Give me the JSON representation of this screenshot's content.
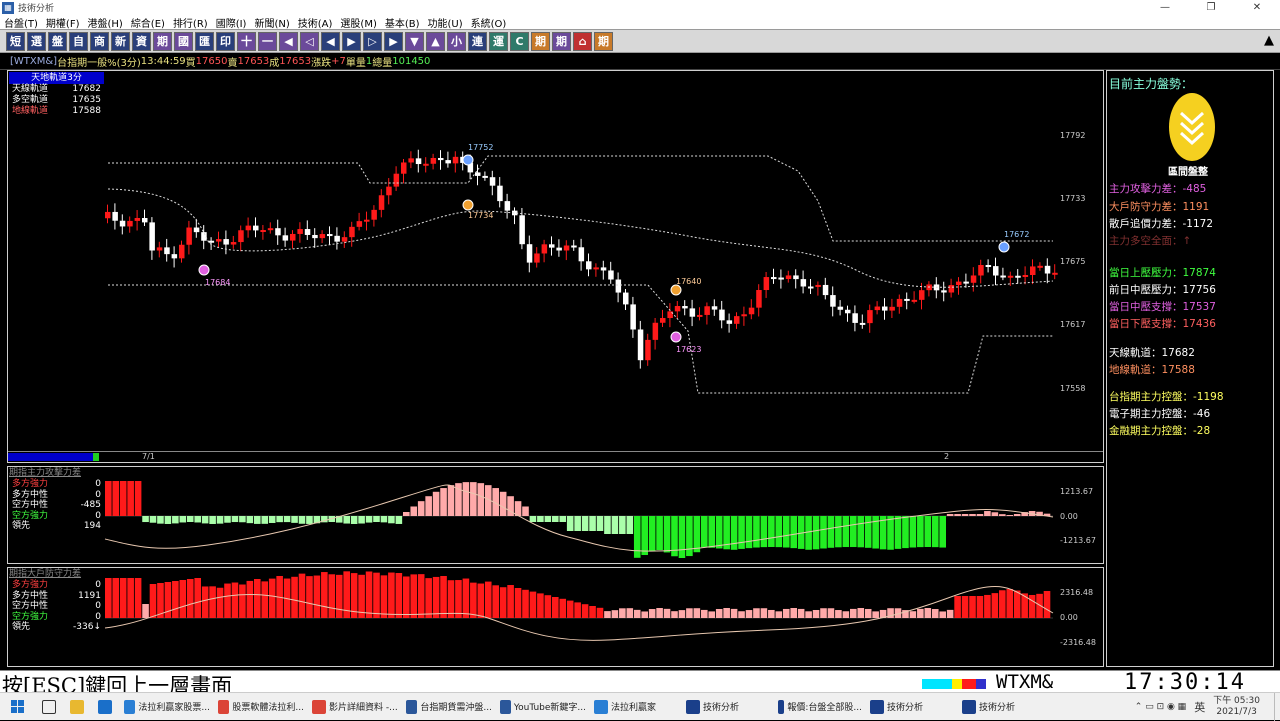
{
  "window": {
    "title": "技術分析",
    "controls": [
      "—",
      "❐",
      "✕"
    ]
  },
  "menu": [
    "台盤(T)",
    "期權(F)",
    "港盤(H)",
    "綜合(E)",
    "排行(R)",
    "國際(I)",
    "新聞(N)",
    "技術(A)",
    "選股(M)",
    "基本(B)",
    "功能(U)",
    "系統(O)"
  ],
  "toolbar": {
    "buttons": [
      "短",
      "選",
      "盤",
      "自",
      "商",
      "新",
      "資",
      "期",
      "國",
      "匯",
      "印",
      "十",
      "一",
      "◀",
      "◁",
      "◀",
      "▶",
      "▷",
      "▶",
      "▼",
      "▲",
      "小",
      "連",
      "運",
      "C",
      "期",
      "期",
      "⌂",
      "期"
    ],
    "collapse": "▲"
  },
  "quote": {
    "symbol": "[WTXM&]",
    "name": "台指期一般%(3分)",
    "time": "13:44:59",
    "buy_label": "買",
    "buy": "17650",
    "sell_label": "賣",
    "sell": "17653",
    "deal_label": "成",
    "deal": "17653",
    "change_label": "漲跌",
    "change": "+7",
    "vol_label": "單量",
    "vol": "1",
    "total_label": "總量",
    "total": "101450"
  },
  "main_legend": {
    "title": "天地軌道3分",
    "rows": [
      {
        "label": "天線軌道",
        "value": "17682",
        "color": "#ffffff"
      },
      {
        "label": "多空軌道",
        "value": "17635",
        "color": "#ffffff"
      },
      {
        "label": "地線軌道",
        "value": "17588",
        "color": "#ff6060"
      }
    ]
  },
  "main_axis": {
    "y_ticks": [
      "17792",
      "17733",
      "17675",
      "17617",
      "17558"
    ],
    "x_ticks": [
      "7/1",
      "2"
    ]
  },
  "markers": [
    "17752",
    "17734",
    "17684",
    "17640",
    "17623",
    "17672"
  ],
  "panel2": {
    "title": "期指主力攻擊力差",
    "rows": [
      {
        "label": "多方強力",
        "value": "0",
        "color": "#ff4040"
      },
      {
        "label": "多方中性",
        "value": "0",
        "color": "#ffffff"
      },
      {
        "label": "空方中性",
        "value": "-485",
        "color": "#ffffff"
      },
      {
        "label": "空方強力",
        "value": "0",
        "color": "#40ff40"
      },
      {
        "label": "領先",
        "value": "194",
        "color": "#ffffff"
      }
    ],
    "y_ticks": [
      "1213.67",
      "0.00",
      "-1213.67"
    ]
  },
  "panel3": {
    "title": "期指大戶防守力差",
    "rows": [
      {
        "label": "多方強力",
        "value": "0",
        "color": "#ff4040"
      },
      {
        "label": "多方中性",
        "value": "1191",
        "color": "#ffffff"
      },
      {
        "label": "空方中性",
        "value": "0",
        "color": "#ffffff"
      },
      {
        "label": "空方強力",
        "value": "0",
        "color": "#40ff40"
      },
      {
        "label": "領先",
        "value": "-336↓",
        "color": "#ffffff"
      }
    ],
    "y_ticks": [
      "2316.48",
      "0.00",
      "-2316.48"
    ]
  },
  "right_panel": {
    "heading": "目前主力盤勢：",
    "badge": "區間盤整",
    "lines": [
      {
        "text": "主力攻擊力差：-485",
        "color": "#e060e0"
      },
      {
        "text": "大戶防守力差：1191",
        "color": "#ff9060"
      },
      {
        "text": "散戶追價力差：-1172",
        "color": "#ffffff"
      },
      {
        "text": "主力多空全面：↑",
        "color": "#803030"
      },
      {
        "text": "當日上壓壓力：17874",
        "color": "#40ff40"
      },
      {
        "text": "前日中壓壓力：17756",
        "color": "#ffffff"
      },
      {
        "text": "當日中壓支撐：17537",
        "color": "#e060e0"
      },
      {
        "text": "當日下壓支撐：17436",
        "color": "#ff6060"
      },
      {
        "text": "天線軌道：17682",
        "color": "#ffffff"
      },
      {
        "text": "地線軌道：17588",
        "color": "#ff9060"
      },
      {
        "text": "台指期主力控盤：-1198",
        "color": "#ffff60"
      },
      {
        "text": "電子期主力控盤：-46",
        "color": "#ffffff"
      },
      {
        "text": "金融期主力控盤：-28",
        "color": "#ffff60"
      }
    ]
  },
  "status": {
    "esc": "按[ESC]鍵回上一層畫面",
    "symbol": "WTXM&",
    "clock": "17:30:14"
  },
  "taskbar": {
    "items": [
      "法拉利贏家股票...",
      "股票軟體法拉利...",
      "影片詳細資料 -...",
      "台指期貨需沖盤...",
      "YouTube新鍵字...",
      "法拉利贏家",
      "技術分析",
      "報價:台盤全部股...",
      "技術分析",
      "技術分析"
    ],
    "time": "下午 05:30",
    "date": "2021/7/3",
    "lang": "英"
  },
  "colors": {
    "up": "#ff1a1a",
    "down": "#ffffff",
    "bull_strong": "#ff1a1a",
    "bull_neutral": "#ffaaaa",
    "bear_neutral": "#aaffaa",
    "bear_strong": "#22ee22"
  }
}
